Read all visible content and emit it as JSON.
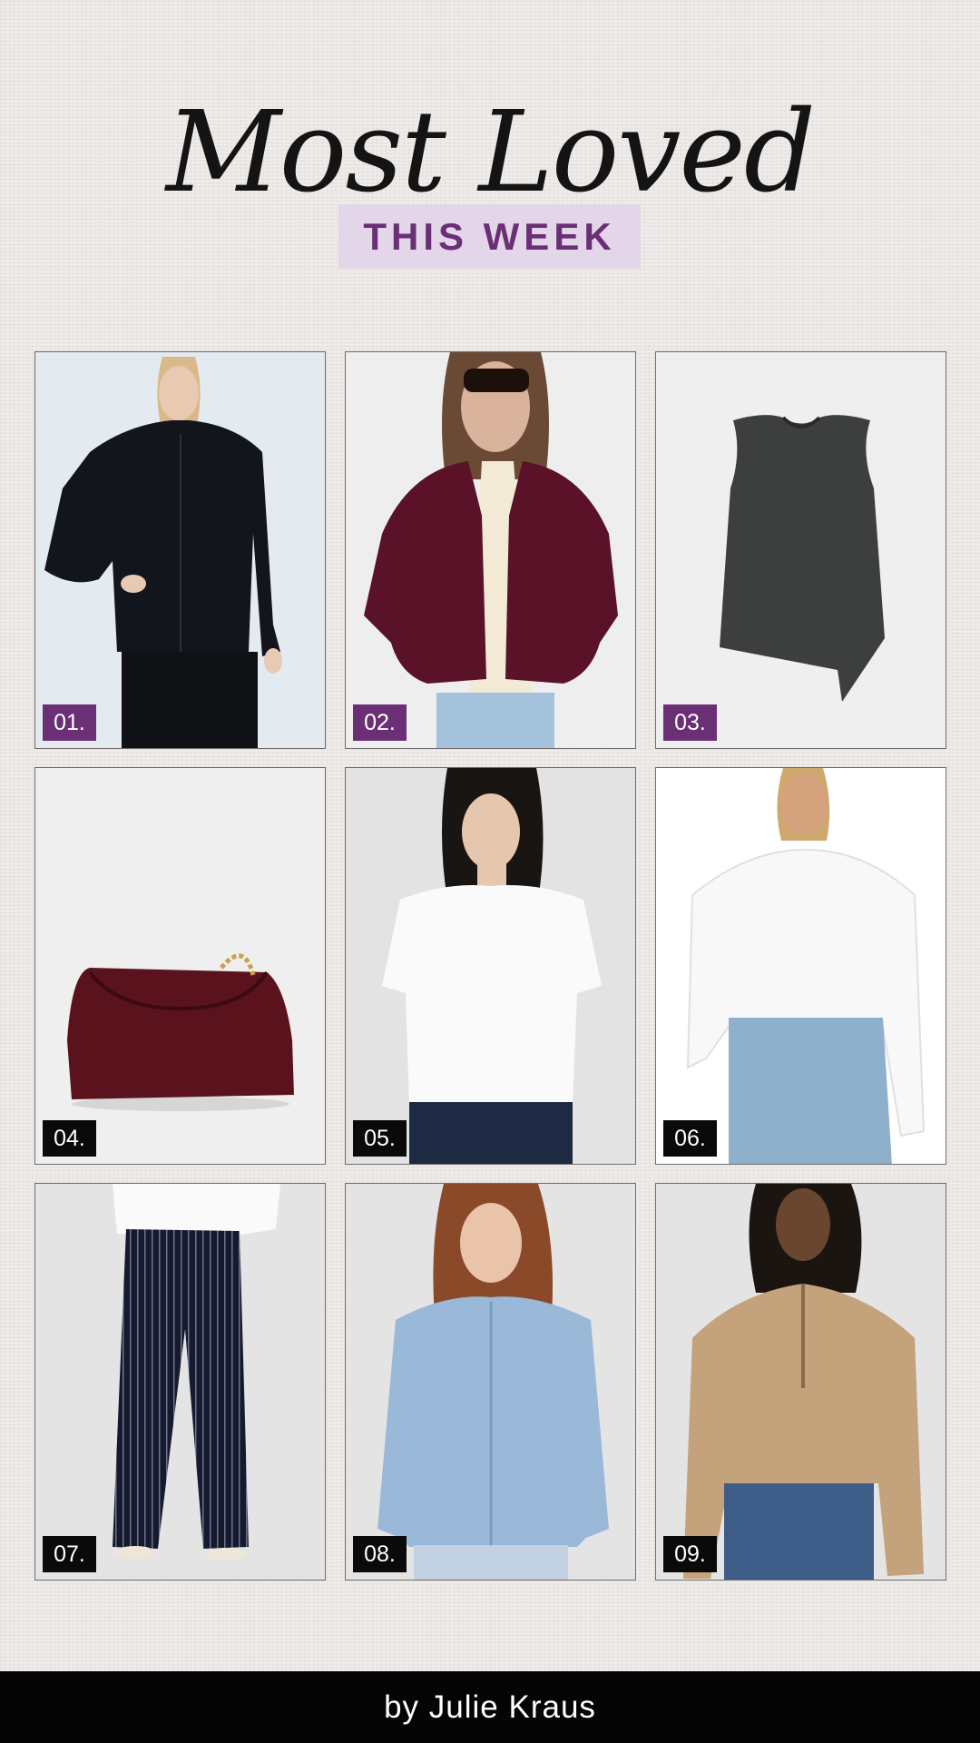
{
  "header": {
    "title": "Most Loved",
    "subtitle": "THIS WEEK"
  },
  "colors": {
    "background": "#ebe7e5",
    "accent_purple": "#6a2f75",
    "subtitle_bg": "#e3d6e9",
    "footer_bg": "#050505"
  },
  "products": [
    {
      "number": "01.",
      "image": "black denim zip jacket on model",
      "badge_style": "purple"
    },
    {
      "number": "02.",
      "image": "burgundy suede bomber jacket on model",
      "badge_style": "purple"
    },
    {
      "number": "03.",
      "image": "charcoal sleeveless asymmetric top",
      "badge_style": "purple"
    },
    {
      "number": "04.",
      "image": "burgundy leather chain shoulder bag",
      "badge_style": "black"
    },
    {
      "number": "05.",
      "image": "white crew neck t-shirt on model",
      "badge_style": "black"
    },
    {
      "number": "06.",
      "image": "white oversized shirt with jeans on model",
      "badge_style": "black"
    },
    {
      "number": "07.",
      "image": "navy pinstripe wide-leg pants on model",
      "badge_style": "black"
    },
    {
      "number": "08.",
      "image": "light wash denim shirt on model",
      "badge_style": "black"
    },
    {
      "number": "09.",
      "image": "camel half-zip sweatshirt on model",
      "badge_style": "black"
    }
  ],
  "footer": {
    "byline": "by Julie Kraus"
  }
}
